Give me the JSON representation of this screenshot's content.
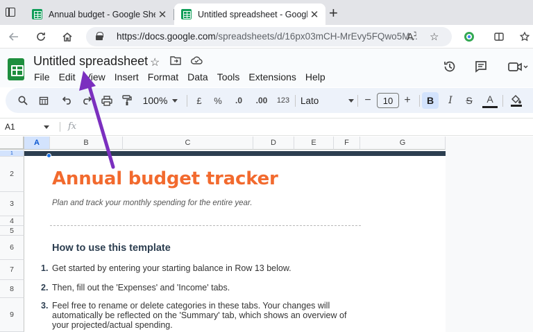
{
  "browser": {
    "tabs": [
      {
        "title": "Annual budget - Google Sheets",
        "active": false
      },
      {
        "title": "Untitled spreadsheet - Google Sh",
        "active": true
      }
    ],
    "close_glyph": "✕",
    "newtab_glyph": "+",
    "url_host": "https://docs.google.com",
    "url_path": "/spreadsheets/d/16px03mCH-MrEvy5FQwo5M...",
    "reader_icon": "A",
    "reader_sup": "ℷ"
  },
  "sheets": {
    "title": "Untitled spreadsheet",
    "menu": [
      "File",
      "Edit",
      "View",
      "Insert",
      "Format",
      "Data",
      "Tools",
      "Extensions",
      "Help"
    ],
    "toolbar": {
      "zoom": "100%",
      "currency": "£",
      "percent": "%",
      "dec_decrease": ".0",
      "dec_increase": ".00",
      "number_format": "123",
      "font": "Lato",
      "minus": "−",
      "font_size": "10",
      "plus": "+",
      "bold": "B",
      "italic": "I",
      "strike": "S",
      "text_color": "A"
    },
    "name_box": "A1",
    "fx": "fx",
    "columns": [
      "A",
      "B",
      "C",
      "D",
      "E",
      "F",
      "G"
    ],
    "rows": [
      "1",
      "2",
      "3",
      "4",
      "5",
      "6",
      "7",
      "8",
      "9"
    ],
    "content": {
      "title": "Annual budget tracker",
      "subtitle": "Plan and track your monthly spending for the entire year.",
      "how_to": "How to use this template",
      "steps": [
        {
          "num": "1.",
          "text": "Get started by entering your starting balance in Row 13 below."
        },
        {
          "num": "2.",
          "text": "Then, fill out the 'Expenses' and 'Income' tabs."
        },
        {
          "num": "3.",
          "text": "Feel free to rename or delete categories in these tabs. Your changes will automatically be reflected on the 'Summary' tab, which shows an overview of your projected/actual spending."
        }
      ]
    }
  },
  "colors": {
    "title_orange": "#f26a2e",
    "header_navy": "#2c3e50",
    "annotation_purple": "#7b2fbf",
    "sheets_green": "#1e8e3e"
  }
}
